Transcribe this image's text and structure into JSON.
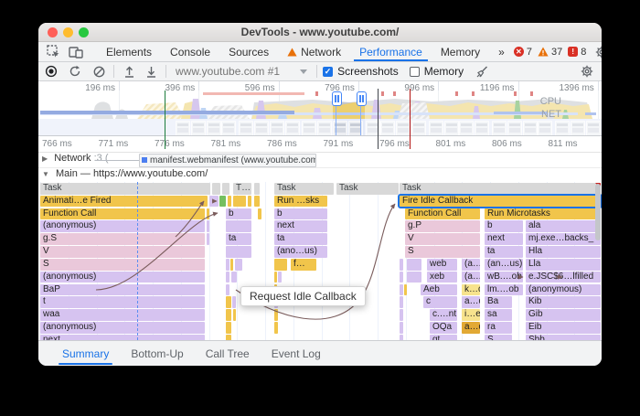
{
  "window": {
    "title": "DevTools - www.youtube.com/"
  },
  "tabbar": {
    "tabs": [
      {
        "label": "Elements"
      },
      {
        "label": "Console"
      },
      {
        "label": "Sources"
      },
      {
        "label": "Network",
        "warning": true
      },
      {
        "label": "Performance",
        "selected": true
      },
      {
        "label": "Memory"
      },
      {
        "label": "»"
      }
    ],
    "errors": "7",
    "warnings": "37",
    "issues": "8"
  },
  "toolbar": {
    "target": "www.youtube.com #1",
    "screenshots_label": "Screenshots",
    "memory_label": "Memory"
  },
  "overview": {
    "ticks": [
      "196 ms",
      "396 ms",
      "596 ms",
      "796 ms",
      "996 ms",
      "1196 ms",
      "1396 ms"
    ],
    "cpu_label": "CPU",
    "net_label": "NET"
  },
  "ruler": {
    "ticks": [
      "766 ms",
      "771 ms",
      "776 ms",
      "781 ms",
      "786 ms",
      "791 ms",
      "796 ms",
      "801 ms",
      "806 ms",
      "811 ms"
    ]
  },
  "network_track": {
    "label": "Network",
    "clipped_text": ":3 (",
    "request": "manifest.webmanifest (www.youtube.com)"
  },
  "main_track": {
    "label": "Main — https://www.youtube.com/"
  },
  "tooltip": "Request Idle Callback",
  "bottom_tabs": {
    "tabs": [
      "Summary",
      "Bottom-Up",
      "Call Tree",
      "Event Log"
    ],
    "selected": 0
  },
  "colors": {
    "accent": "#1a73e8",
    "task_gray": "#d8d8d8",
    "script_yellow": "#f1c54b",
    "purple": "#d6c3f0",
    "pink": "#eac8da",
    "green": "#74bf5f",
    "light_yellow": "#f7e38d",
    "orange": "#e2a934",
    "long_task_red": "#c5221f"
  },
  "flame": {
    "bars": [
      [
        2,
        0,
        186,
        "gray",
        "Task",
        "hdr"
      ],
      [
        190,
        0,
        9,
        "gray",
        "",
        "hdr"
      ],
      [
        201,
        0,
        8,
        "gray",
        "",
        "hdr"
      ],
      [
        213,
        0,
        20,
        "gray",
        "T…",
        "hdr"
      ],
      [
        236,
        0,
        6,
        "gray",
        "",
        "hdr"
      ],
      [
        258,
        0,
        65,
        "gray",
        "Task",
        "hdr"
      ],
      [
        326,
        0,
        68,
        "gray",
        "Task",
        "hdr"
      ],
      [
        395,
        0,
        220,
        "gray",
        "Task",
        "hdr corner"
      ],
      [
        2,
        1,
        183,
        "yellow",
        "Animati…e Fired",
        ""
      ],
      [
        187,
        1,
        10,
        "purple",
        "",
        ""
      ],
      [
        198,
        1,
        7,
        "green",
        "",
        ""
      ],
      [
        207,
        1,
        4,
        "yellow",
        "",
        ""
      ],
      [
        213,
        1,
        14,
        "yellow",
        "",
        ""
      ],
      [
        229,
        1,
        4,
        "yellow",
        "",
        ""
      ],
      [
        236,
        1,
        6,
        "yellow",
        "",
        ""
      ],
      [
        258,
        1,
        58,
        "yellow",
        "Run …sks",
        ""
      ],
      [
        395,
        1,
        220,
        "yellow",
        "Fire Idle Callback",
        "sel corner"
      ],
      [
        2,
        2,
        180,
        "yellow",
        "Function Call",
        ""
      ],
      [
        184,
        2,
        3,
        "yellow",
        "",
        ""
      ],
      [
        205,
        2,
        28,
        "purple",
        "b",
        ""
      ],
      [
        240,
        2,
        4,
        "yellow",
        "",
        ""
      ],
      [
        258,
        2,
        58,
        "purple",
        "b",
        ""
      ],
      [
        401,
        2,
        82,
        "yellow",
        "Function Call",
        ""
      ],
      [
        488,
        2,
        127,
        "yellow",
        "Run Microtasks",
        ""
      ],
      [
        2,
        3,
        180,
        "purple",
        "(anonymous)",
        ""
      ],
      [
        184,
        3,
        3,
        "purple",
        "",
        ""
      ],
      [
        205,
        3,
        28,
        "purple",
        "",
        ""
      ],
      [
        258,
        3,
        58,
        "purple",
        "next",
        ""
      ],
      [
        401,
        3,
        82,
        "pink",
        "g.P",
        ""
      ],
      [
        488,
        3,
        42,
        "purple",
        "b",
        ""
      ],
      [
        533,
        3,
        82,
        "purple",
        "ala",
        ""
      ],
      [
        2,
        4,
        180,
        "pink",
        "g.S",
        ""
      ],
      [
        184,
        4,
        3,
        "purple",
        "",
        ""
      ],
      [
        205,
        4,
        28,
        "purple",
        "ta",
        ""
      ],
      [
        258,
        4,
        58,
        "purple",
        "ta",
        ""
      ],
      [
        401,
        4,
        82,
        "pink",
        "V",
        ""
      ],
      [
        488,
        4,
        42,
        "purple",
        "next",
        ""
      ],
      [
        533,
        4,
        82,
        "purple",
        "mj.exe…backs_",
        ""
      ],
      [
        2,
        5,
        180,
        "pink",
        "V",
        ""
      ],
      [
        205,
        5,
        28,
        "purple",
        "",
        ""
      ],
      [
        258,
        5,
        58,
        "purple",
        "(ano…us)",
        ""
      ],
      [
        401,
        5,
        82,
        "pink",
        "S",
        ""
      ],
      [
        488,
        5,
        42,
        "purple",
        "ta",
        ""
      ],
      [
        533,
        5,
        82,
        "purple",
        "Hla",
        ""
      ],
      [
        2,
        6,
        180,
        "pink",
        "S",
        ""
      ],
      [
        205,
        6,
        4,
        "purple",
        "",
        ""
      ],
      [
        210,
        6,
        3,
        "yellow",
        "",
        ""
      ],
      [
        215,
        6,
        8,
        "purple",
        "",
        ""
      ],
      [
        258,
        6,
        14,
        "yellow",
        "",
        ""
      ],
      [
        276,
        6,
        28,
        "yellow",
        "f…",
        ""
      ],
      [
        395,
        6,
        4,
        "purple",
        "",
        ""
      ],
      [
        403,
        6,
        16,
        "purple",
        "",
        ""
      ],
      [
        425,
        6,
        33,
        "purple",
        "web",
        ""
      ],
      [
        463,
        6,
        20,
        "purple",
        "(a…)",
        ""
      ],
      [
        488,
        6,
        42,
        "purple",
        "(an…us)",
        ""
      ],
      [
        533,
        6,
        82,
        "purple",
        "Lla",
        ""
      ],
      [
        2,
        7,
        180,
        "purple",
        "(anonymous)",
        ""
      ],
      [
        205,
        7,
        4,
        "purple",
        "",
        ""
      ],
      [
        211,
        7,
        6,
        "purple",
        "",
        ""
      ],
      [
        258,
        7,
        3,
        "yellow",
        "",
        ""
      ],
      [
        262,
        7,
        4,
        "purple",
        "",
        ""
      ],
      [
        395,
        7,
        4,
        "purple",
        "",
        ""
      ],
      [
        403,
        7,
        16,
        "purple",
        "",
        ""
      ],
      [
        425,
        7,
        33,
        "purple",
        "xeb",
        ""
      ],
      [
        463,
        7,
        20,
        "purple",
        "(a…)",
        ""
      ],
      [
        488,
        7,
        42,
        "purple",
        "wB.…ob",
        ""
      ],
      [
        533,
        7,
        82,
        "purple",
        "e.JSC$6…lfilled",
        ""
      ],
      [
        2,
        8,
        180,
        "purple",
        "BaP",
        ""
      ],
      [
        205,
        8,
        4,
        "purple",
        "",
        ""
      ],
      [
        258,
        8,
        3,
        "yellow",
        "",
        ""
      ],
      [
        395,
        8,
        4,
        "purple",
        "",
        ""
      ],
      [
        400,
        8,
        3,
        "yellow",
        "",
        ""
      ],
      [
        418,
        8,
        40,
        "purple",
        "Aeb",
        ""
      ],
      [
        463,
        8,
        20,
        "lightyellow",
        "k…d",
        ""
      ],
      [
        488,
        8,
        42,
        "purple",
        "lm.…ob",
        ""
      ],
      [
        533,
        8,
        82,
        "purple",
        "(anonymous)",
        ""
      ],
      [
        2,
        9,
        180,
        "purple",
        "t",
        ""
      ],
      [
        205,
        9,
        6,
        "yellow",
        "",
        ""
      ],
      [
        212,
        9,
        4,
        "purple",
        "",
        ""
      ],
      [
        258,
        9,
        4,
        "purple",
        "",
        ""
      ],
      [
        395,
        9,
        4,
        "purple",
        "",
        ""
      ],
      [
        421,
        9,
        37,
        "purple",
        "c",
        ""
      ],
      [
        463,
        9,
        20,
        "purple",
        "a…d",
        ""
      ],
      [
        488,
        9,
        30,
        "purple",
        "Ba",
        ""
      ],
      [
        533,
        9,
        82,
        "purple",
        "Kib",
        ""
      ],
      [
        2,
        10,
        180,
        "purple",
        "waa",
        ""
      ],
      [
        205,
        10,
        6,
        "yellow",
        "",
        ""
      ],
      [
        213,
        10,
        3,
        "yellow",
        "",
        ""
      ],
      [
        258,
        10,
        4,
        "yellow",
        "",
        ""
      ],
      [
        395,
        10,
        4,
        "purple",
        "",
        ""
      ],
      [
        428,
        10,
        30,
        "purple",
        "c.…nt",
        ""
      ],
      [
        463,
        10,
        20,
        "lightyellow",
        "i…e",
        ""
      ],
      [
        488,
        10,
        30,
        "purple",
        "sa",
        ""
      ],
      [
        533,
        10,
        82,
        "purple",
        "Gib",
        ""
      ],
      [
        2,
        11,
        180,
        "purple",
        "(anonymous)",
        ""
      ],
      [
        205,
        11,
        6,
        "yellow",
        "",
        ""
      ],
      [
        258,
        11,
        4,
        "yellow",
        "",
        ""
      ],
      [
        395,
        11,
        4,
        "purple",
        "",
        ""
      ],
      [
        428,
        11,
        30,
        "purple",
        "OQa",
        ""
      ],
      [
        463,
        11,
        20,
        "orange",
        "a…d",
        ""
      ],
      [
        488,
        11,
        30,
        "purple",
        "ra",
        ""
      ],
      [
        533,
        11,
        82,
        "purple",
        "Eib",
        ""
      ],
      [
        2,
        12,
        180,
        "purple",
        "next",
        ""
      ],
      [
        205,
        12,
        6,
        "yellow",
        "",
        ""
      ],
      [
        395,
        12,
        4,
        "purple",
        "",
        ""
      ],
      [
        428,
        12,
        30,
        "purple",
        "gt",
        ""
      ],
      [
        488,
        12,
        30,
        "purple",
        "S",
        ""
      ],
      [
        533,
        12,
        82,
        "purple",
        "Sbb",
        ""
      ]
    ]
  }
}
